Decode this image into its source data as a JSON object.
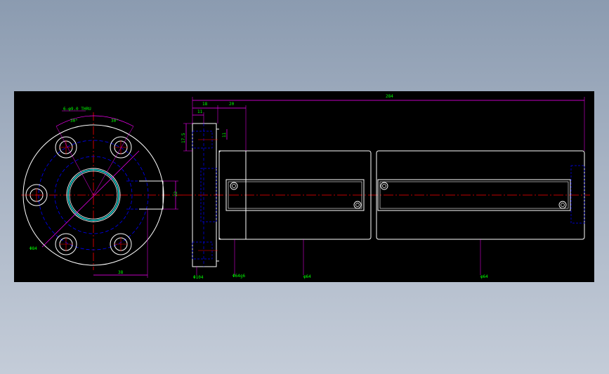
{
  "drawing": {
    "background": "#000000",
    "colors": {
      "outline": "#ffffff",
      "center_line": "#ff0000",
      "hidden_line": "#0000ff",
      "dimension_line": "#ff00ff",
      "dimension_text": "#00ff00",
      "bore_accent": "#00ffff"
    },
    "front_view": {
      "angle_left": "30°",
      "angle_right": "30°",
      "hole_note": "6-φ9.0 THRU",
      "dia_label": "Φ84",
      "offset_dim": "38",
      "flat_dim": "22"
    },
    "side_view": {
      "overall_length": "284",
      "flange_width": "18",
      "step_width": "11",
      "pilot_length": "20",
      "hole_height": "11",
      "flange_height": "17.5",
      "flange_dia": "Φ104",
      "pilot_dia": "Φ64g6",
      "nut_dia_1": "φ64",
      "nut_dia_2": "φ64"
    }
  }
}
